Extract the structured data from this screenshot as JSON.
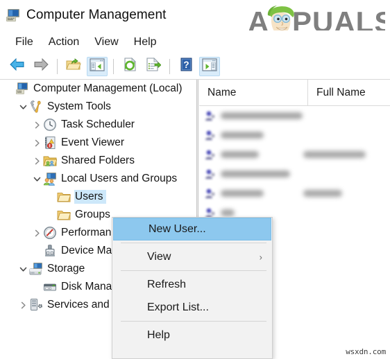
{
  "window": {
    "title": "Computer Management",
    "icon": "computer-management-icon"
  },
  "branding": {
    "logo_text": "PUALS",
    "logo_letter": "A",
    "logo_name": "appuals-logo"
  },
  "menubar": {
    "items": [
      {
        "label": "File",
        "name": "menu-file"
      },
      {
        "label": "Action",
        "name": "menu-action"
      },
      {
        "label": "View",
        "name": "menu-view"
      },
      {
        "label": "Help",
        "name": "menu-help"
      }
    ]
  },
  "toolbar": {
    "buttons": [
      {
        "name": "back-button",
        "icon": "arrow-left-icon",
        "active": false
      },
      {
        "name": "forward-button",
        "icon": "arrow-right-icon",
        "active": false
      },
      {
        "name": "up-one-level-button",
        "icon": "folder-up-icon",
        "active": false
      },
      {
        "name": "show-hide-console-tree-button",
        "icon": "console-tree-icon",
        "active": true
      },
      {
        "name": "refresh-button",
        "icon": "refresh-page-icon",
        "active": false
      },
      {
        "name": "export-list-button",
        "icon": "export-list-icon",
        "active": false
      },
      {
        "name": "help-button",
        "icon": "question-mark-icon",
        "active": false
      },
      {
        "name": "show-hide-action-pane-button",
        "icon": "action-pane-icon",
        "active": true
      }
    ]
  },
  "tree": {
    "items": [
      {
        "label": "Computer Management (Local)",
        "icon": "computer-icon",
        "indent": 0,
        "twisty": "none",
        "selected": false,
        "name": "tree-item-computer-management-local"
      },
      {
        "label": "System Tools",
        "icon": "tools-icon",
        "indent": 1,
        "twisty": "expanded",
        "selected": false,
        "name": "tree-item-system-tools"
      },
      {
        "label": "Task Scheduler",
        "icon": "clock-icon",
        "indent": 2,
        "twisty": "collapsed",
        "selected": false,
        "name": "tree-item-task-scheduler"
      },
      {
        "label": "Event Viewer",
        "icon": "event-viewer-icon",
        "indent": 2,
        "twisty": "collapsed",
        "selected": false,
        "name": "tree-item-event-viewer"
      },
      {
        "label": "Shared Folders",
        "icon": "shared-folders-icon",
        "indent": 2,
        "twisty": "collapsed",
        "selected": false,
        "name": "tree-item-shared-folders"
      },
      {
        "label": "Local Users and Groups",
        "icon": "users-groups-icon",
        "indent": 2,
        "twisty": "expanded",
        "selected": false,
        "name": "tree-item-local-users-and-groups"
      },
      {
        "label": "Users",
        "icon": "folder-icon",
        "indent": 3,
        "twisty": "none",
        "selected": true,
        "name": "tree-item-users"
      },
      {
        "label": "Groups",
        "icon": "folder-icon",
        "indent": 3,
        "twisty": "none",
        "selected": false,
        "name": "tree-item-groups"
      },
      {
        "label": "Performance",
        "icon": "performance-icon",
        "indent": 2,
        "twisty": "collapsed",
        "selected": false,
        "name": "tree-item-performance"
      },
      {
        "label": "Device Manager",
        "icon": "device-manager-icon",
        "indent": 2,
        "twisty": "none",
        "selected": false,
        "name": "tree-item-device-manager"
      },
      {
        "label": "Storage",
        "icon": "storage-icon",
        "indent": 1,
        "twisty": "expanded",
        "selected": false,
        "name": "tree-item-storage"
      },
      {
        "label": "Disk Management",
        "icon": "disk-management-icon",
        "indent": 2,
        "twisty": "none",
        "selected": false,
        "name": "tree-item-disk-management"
      },
      {
        "label": "Services and Applications",
        "icon": "services-icon",
        "indent": 1,
        "twisty": "collapsed",
        "selected": false,
        "name": "tree-item-services-and-applications"
      }
    ]
  },
  "list": {
    "columns": [
      {
        "label": "Name",
        "name": "column-header-name"
      },
      {
        "label": "Full Name",
        "name": "column-header-full-name"
      }
    ],
    "rows": [
      {
        "name_width": 118,
        "fullname_width": 0,
        "redacted": true
      },
      {
        "name_width": 62,
        "fullname_width": 0,
        "redacted": true
      },
      {
        "name_width": 55,
        "fullname_width": 90,
        "redacted": true
      },
      {
        "name_width": 100,
        "fullname_width": 0,
        "redacted": true
      },
      {
        "name_width": 62,
        "fullname_width": 56,
        "redacted": true
      },
      {
        "name_width": 20,
        "fullname_width": 0,
        "redacted": true
      },
      {
        "name_width": 44,
        "fullname_width": 0,
        "redacted": true
      }
    ]
  },
  "context_menu": {
    "name": "users-context-menu",
    "items": [
      {
        "label": "New User...",
        "type": "item",
        "highlighted": true,
        "submenu": false,
        "name": "context-menu-item-new-user"
      },
      {
        "type": "separator"
      },
      {
        "label": "View",
        "type": "item",
        "highlighted": false,
        "submenu": true,
        "name": "context-menu-item-view"
      },
      {
        "type": "separator"
      },
      {
        "label": "Refresh",
        "type": "item",
        "highlighted": false,
        "submenu": false,
        "name": "context-menu-item-refresh"
      },
      {
        "label": "Export List...",
        "type": "item",
        "highlighted": false,
        "submenu": false,
        "name": "context-menu-item-export-list"
      },
      {
        "type": "separator"
      },
      {
        "label": "Help",
        "type": "item",
        "highlighted": false,
        "submenu": false,
        "name": "context-menu-item-help"
      }
    ],
    "submenu_arrow": "›"
  },
  "watermark": {
    "text": "wsxdn.com"
  },
  "colors": {
    "highlight": "#8dc8ee",
    "selection": "#cde8fa",
    "toolbar_active": "#d9ecfa",
    "menu_bg": "#f2f2f2",
    "logo_gray": "#7f7f7f",
    "logo_green": "#8cc63f"
  }
}
